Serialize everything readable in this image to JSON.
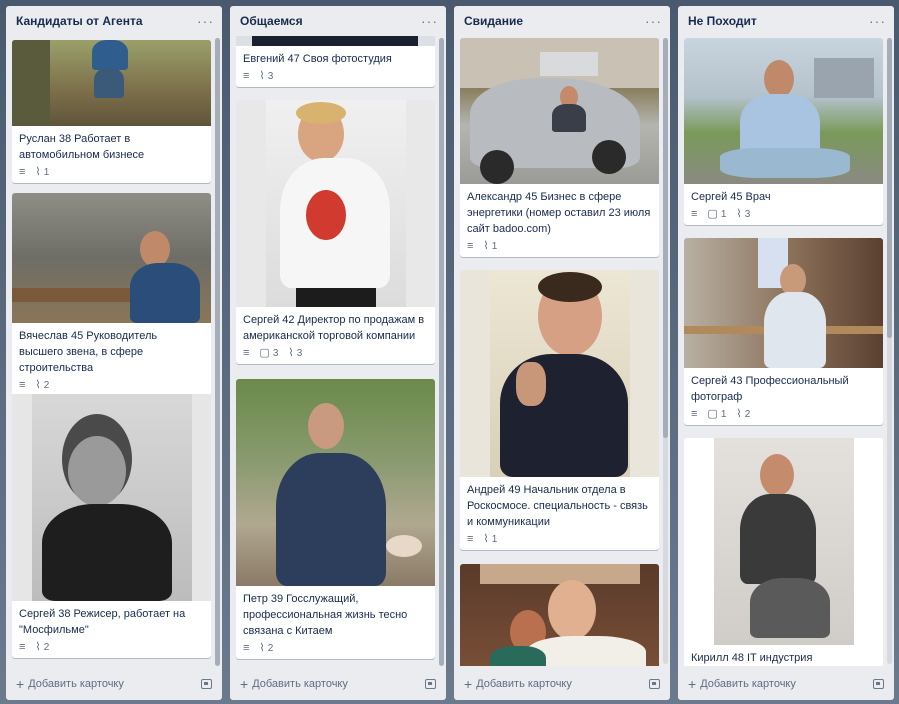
{
  "lists": [
    {
      "title": "Кандидаты от Агента",
      "add_label": "Добавить карточку",
      "cards": [
        {
          "title": "Руслан 38 Работает в автомобильном бизнесе",
          "attachments": "1"
        },
        {
          "title": "Вячеслав 45 Руководитель высшего звена, в сфере строительства",
          "attachments": "2"
        },
        {
          "title": "Сергей 38 Режисер, работает на \"Мосфильме\"",
          "attachments": "2"
        }
      ]
    },
    {
      "title": "Общаемся",
      "add_label": "Добавить карточку",
      "cards": [
        {
          "title": "Евгений 47 Своя фотостудия",
          "attachments": "3"
        },
        {
          "title": "Сергей 42 Директор по продажам в американской торговой компании",
          "comments": "3",
          "attachments": "3"
        },
        {
          "title": "Петр 39 Госслужащий, профессиональная жизнь тесно связана с Китаем",
          "attachments": "2"
        }
      ]
    },
    {
      "title": "Свидание",
      "add_label": "Добавить карточку",
      "cards": [
        {
          "title": "Александр 45 Бизнес в сфере энергетики (номер оставил 23 июля сайт badoo.com)",
          "attachments": "1"
        },
        {
          "title": "Андрей 49 Начальник отдела в Роскосмосе. специальность - связь и коммуникации",
          "attachments": "1"
        },
        {
          "title": ""
        }
      ]
    },
    {
      "title": "Не Походит",
      "add_label": "Добавить карточку",
      "cards": [
        {
          "title": "Сергей 45 Врач",
          "comments": "1",
          "attachments": "3"
        },
        {
          "title": "Сергей 43 Профессиональный фотограф",
          "comments": "1",
          "attachments": "2"
        },
        {
          "title": "Кирилл 48 IT индустрия"
        }
      ]
    }
  ],
  "icons": {
    "menu": "ellipsis-icon",
    "description": "description-icon",
    "attachment": "paperclip-icon",
    "comment": "comment-icon",
    "template": "card-template-icon"
  },
  "colors": {
    "list_bg": "#ebecf0",
    "card_bg": "#ffffff",
    "text": "#172b4d",
    "muted": "#5e6c84"
  }
}
